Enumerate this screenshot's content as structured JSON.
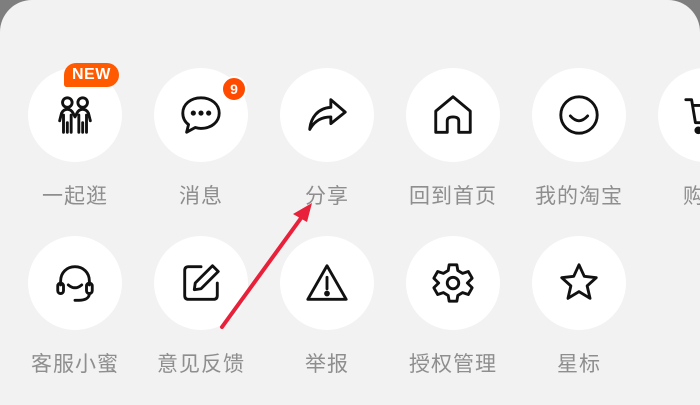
{
  "row1": [
    {
      "label": "一起逛",
      "icon": "people-icon",
      "badge": "NEW"
    },
    {
      "label": "消息",
      "icon": "chat-bubble-icon",
      "badge_count": "9"
    },
    {
      "label": "分享",
      "icon": "share-arrow-icon"
    },
    {
      "label": "回到首页",
      "icon": "home-icon"
    },
    {
      "label": "我的淘宝",
      "icon": "smiley-icon"
    },
    {
      "label": "购物",
      "icon": "cart-icon"
    }
  ],
  "row2": [
    {
      "label": "客服小蜜",
      "icon": "headset-icon"
    },
    {
      "label": "意见反馈",
      "icon": "edit-icon"
    },
    {
      "label": "举报",
      "icon": "warning-icon"
    },
    {
      "label": "授权管理",
      "icon": "gear-icon"
    },
    {
      "label": "星标",
      "icon": "star-icon"
    }
  ],
  "colors": {
    "sheet_bg": "#f2f2f2",
    "circle_bg": "#ffffff",
    "label": "#8e8e8e",
    "accent": "#ff5a00",
    "annotation_arrow": "#e8203a"
  }
}
